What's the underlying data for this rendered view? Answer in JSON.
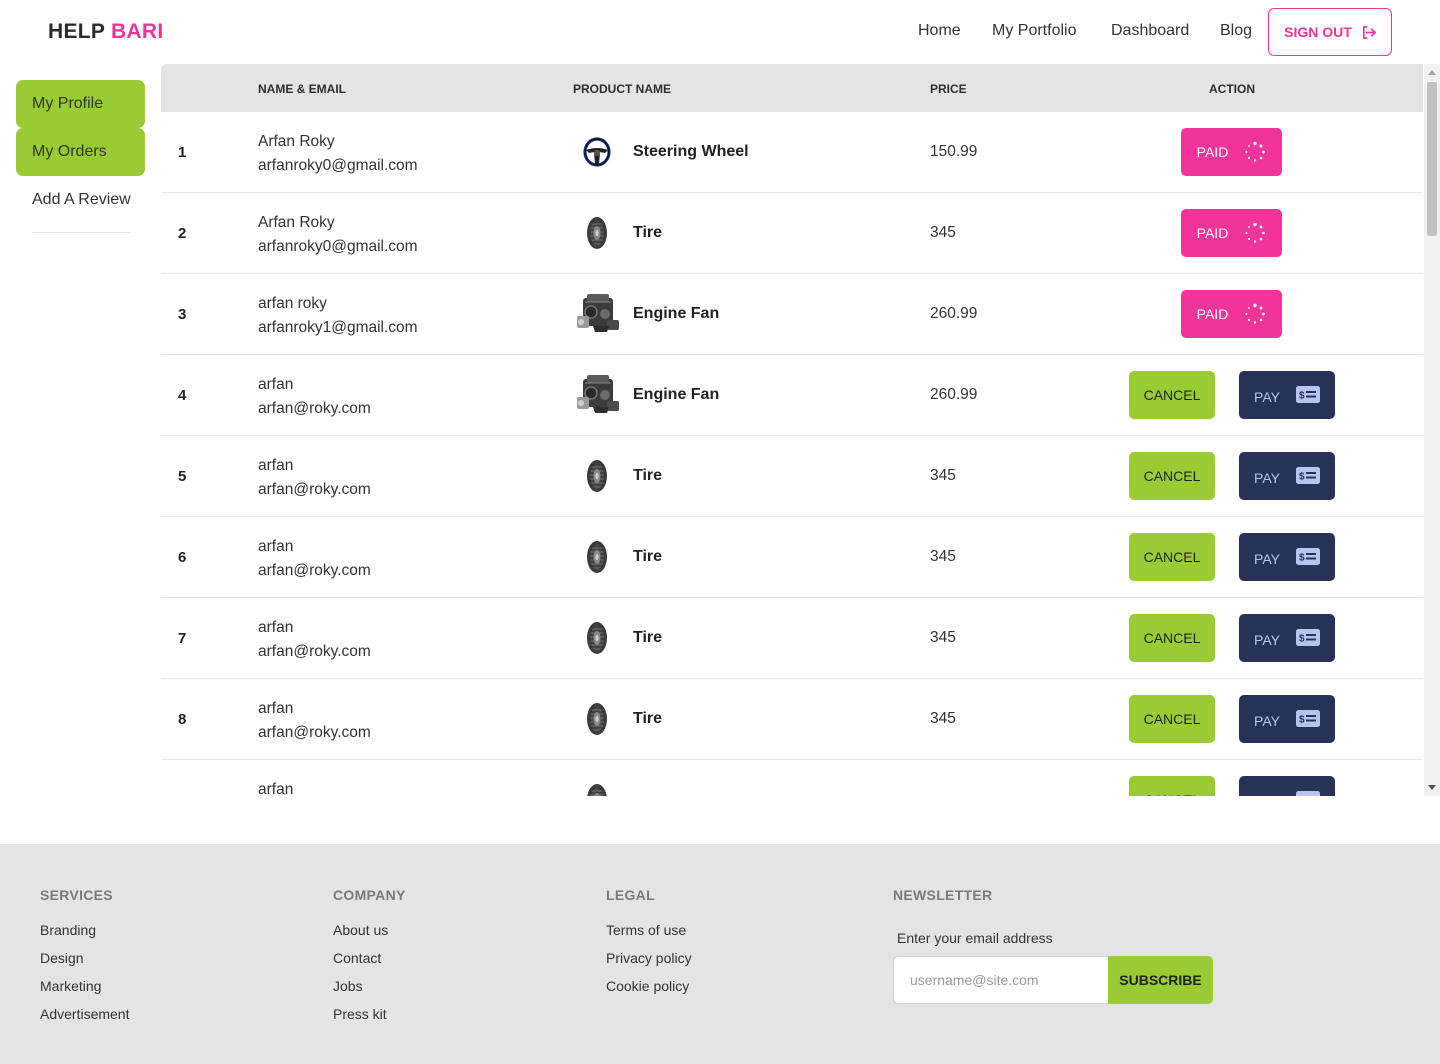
{
  "brand": {
    "part1": "HELP",
    "part2": "BARI"
  },
  "nav": [
    "Home",
    "My Portfolio",
    "Dashboard",
    "Blog"
  ],
  "signout_label": "SIGN OUT",
  "sidebar": [
    {
      "label": "My Profile",
      "active": true
    },
    {
      "label": "My Orders",
      "active": true
    },
    {
      "label": "Add A Review",
      "active": false
    }
  ],
  "table": {
    "headers": [
      "NAME & EMAIL",
      "PRODUCT NAME",
      "PRICE",
      "ACTION"
    ],
    "rows": [
      {
        "index": "1",
        "name": "Arfan Roky",
        "email": "arfanroky0@gmail.com",
        "product": "Steering Wheel",
        "icon": "steering-wheel",
        "price": "150.99",
        "status": "paid"
      },
      {
        "index": "2",
        "name": "Arfan Roky",
        "email": "arfanroky0@gmail.com",
        "product": "Tire",
        "icon": "tire",
        "price": "345",
        "status": "paid"
      },
      {
        "index": "3",
        "name": "arfan roky",
        "email": "arfanroky1@gmail.com",
        "product": "Engine Fan",
        "icon": "engine",
        "price": "260.99",
        "status": "paid"
      },
      {
        "index": "4",
        "name": "arfan",
        "email": "arfan@roky.com",
        "product": "Engine Fan",
        "icon": "engine",
        "price": "260.99",
        "status": "unpaid"
      },
      {
        "index": "5",
        "name": "arfan",
        "email": "arfan@roky.com",
        "product": "Tire",
        "icon": "tire",
        "price": "345",
        "status": "unpaid"
      },
      {
        "index": "6",
        "name": "arfan",
        "email": "arfan@roky.com",
        "product": "Tire",
        "icon": "tire",
        "price": "345",
        "status": "unpaid"
      },
      {
        "index": "7",
        "name": "arfan",
        "email": "arfan@roky.com",
        "product": "Tire",
        "icon": "tire",
        "price": "345",
        "status": "unpaid"
      },
      {
        "index": "8",
        "name": "arfan",
        "email": "arfan@roky.com",
        "product": "Tire",
        "icon": "tire",
        "price": "345",
        "status": "unpaid"
      },
      {
        "index": "",
        "name": "arfan",
        "email": "",
        "product": "",
        "icon": "tire",
        "price": "",
        "status": "unpaid"
      }
    ],
    "labels": {
      "paid": "PAID",
      "cancel": "CANCEL",
      "pay": "PAY"
    }
  },
  "footer": {
    "columns": [
      {
        "heading": "SERVICES",
        "links": [
          "Branding",
          "Design",
          "Marketing",
          "Advertisement"
        ]
      },
      {
        "heading": "COMPANY",
        "links": [
          "About us",
          "Contact",
          "Jobs",
          "Press kit"
        ]
      },
      {
        "heading": "LEGAL",
        "links": [
          "Terms of use",
          "Privacy policy",
          "Cookie policy"
        ]
      }
    ],
    "newsletter": {
      "heading": "NEWSLETTER",
      "label": "Enter your email address",
      "placeholder": "username@site.com",
      "button": "SUBSCRIBE"
    }
  },
  "colors": {
    "accent_pink": "#f0349a",
    "accent_green": "#99cc33",
    "navy": "#283259"
  }
}
